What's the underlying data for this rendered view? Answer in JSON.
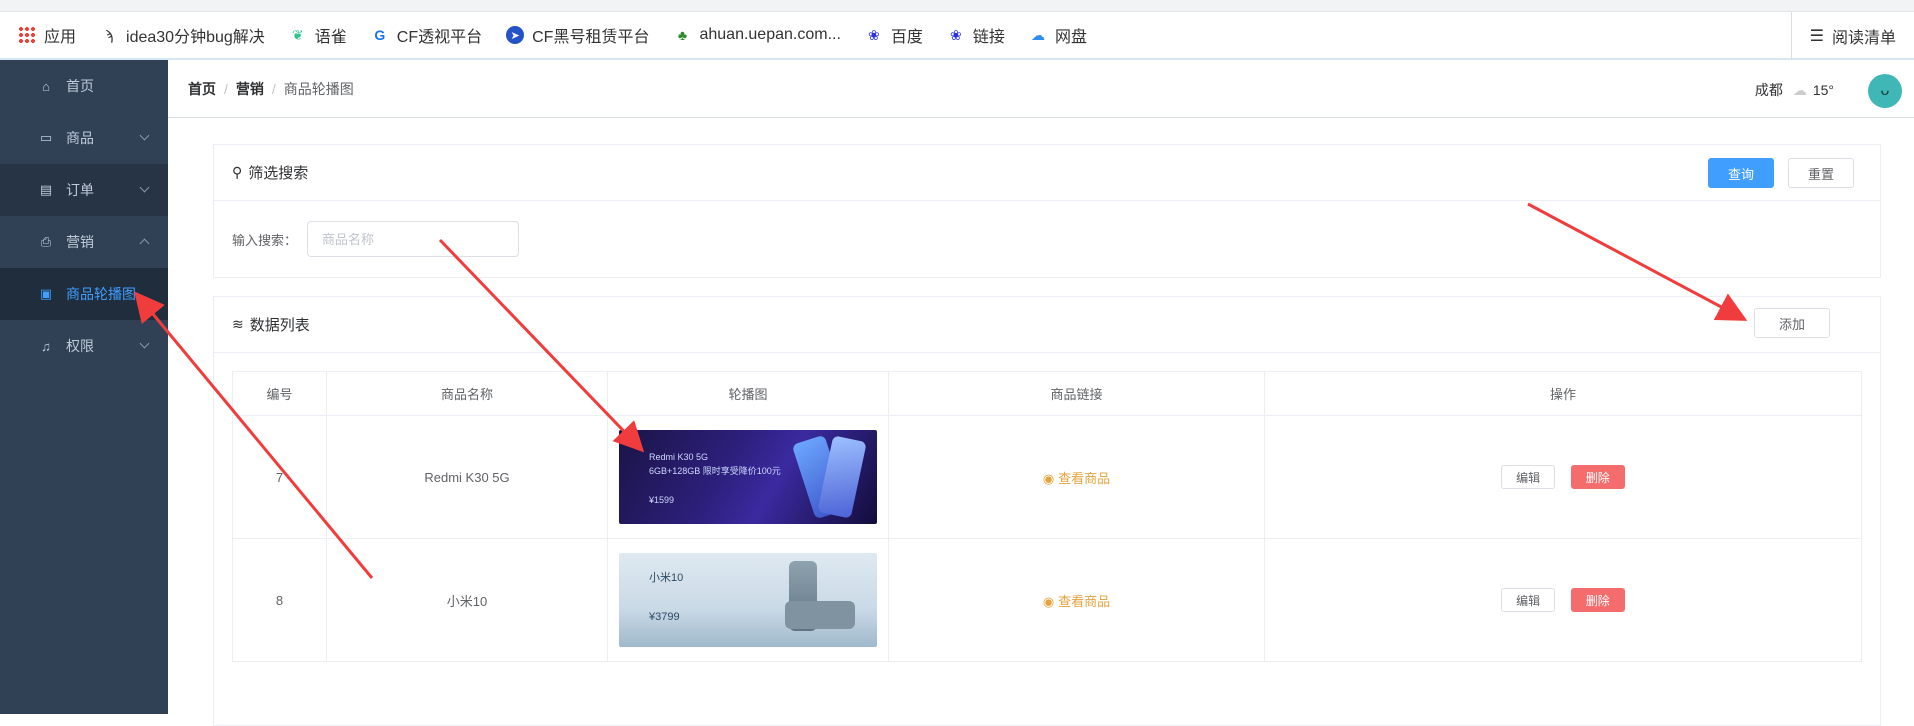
{
  "bookmarks": [
    {
      "label": "应用",
      "icon": "apps-grid-icon"
    },
    {
      "label": "idea30分钟bug解决",
      "icon": "idea-icon"
    },
    {
      "label": "语雀",
      "icon": "yuque-icon"
    },
    {
      "label": "CF透视平台",
      "icon": "cf-icon"
    },
    {
      "label": "CF黑号租赁平台",
      "icon": "cf-rent-icon"
    },
    {
      "label": "ahuan.uepan.com...",
      "icon": "tree-icon"
    },
    {
      "label": "百度",
      "icon": "baidu-paw-icon"
    },
    {
      "label": "链接",
      "icon": "baidu-paw-icon"
    },
    {
      "label": "网盘",
      "icon": "cloud-disk-icon"
    }
  ],
  "reading_list": "阅读清单",
  "sidebar": {
    "items": [
      {
        "label": "首页",
        "icon": "home-icon"
      },
      {
        "label": "商品",
        "icon": "bag-icon"
      },
      {
        "label": "订单",
        "icon": "clipboard-icon"
      },
      {
        "label": "营销",
        "icon": "marketing-icon"
      },
      {
        "label": "商品轮播图",
        "icon": "image-icon"
      },
      {
        "label": "权限",
        "icon": "bell-icon"
      }
    ]
  },
  "breadcrumb": {
    "home": "首页",
    "section": "营销",
    "current": "商品轮播图"
  },
  "weather": {
    "city": "成都",
    "temp": "15°"
  },
  "filter": {
    "title": "筛选搜索",
    "query_label": "查询",
    "reset_label": "重置",
    "search_label": "输入搜索：",
    "search_placeholder": "商品名称"
  },
  "list": {
    "title": "数据列表",
    "add_label": "添加",
    "headers": {
      "id": "编号",
      "name": "商品名称",
      "image": "轮播图",
      "link": "商品链接",
      "ops": "操作"
    },
    "rows": [
      {
        "id": "7",
        "name": "Redmi K30 5G",
        "banner_text": "Redmi K30 5G",
        "banner_sub": "6GB+128GB 限时享受降价100元",
        "banner_price": "¥1599",
        "link": "查看商品",
        "edit": "编辑",
        "delete": "删除"
      },
      {
        "id": "8",
        "name": "小米10",
        "banner_text": "小米10",
        "banner_sub": "",
        "banner_price": "¥3799",
        "link": "查看商品",
        "edit": "编辑",
        "delete": "删除"
      }
    ]
  },
  "colors": {
    "primary": "#409eff",
    "danger": "#f56c6c",
    "warning": "#e6a23c",
    "sidebar": "#304156"
  }
}
